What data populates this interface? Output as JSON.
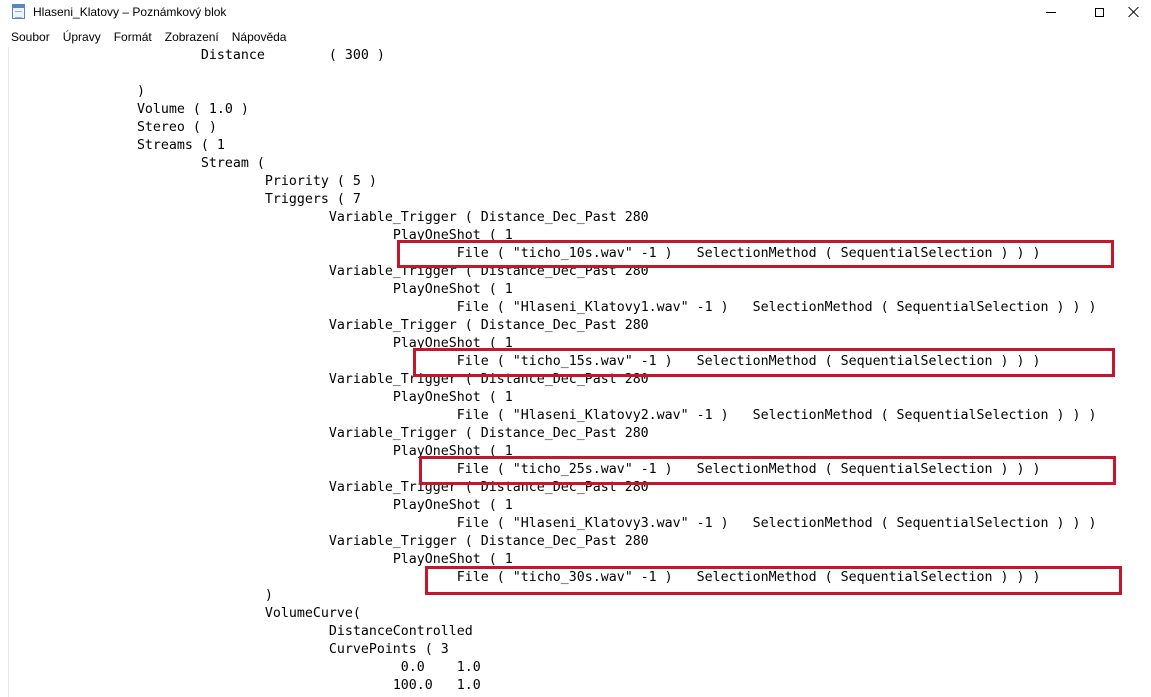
{
  "window": {
    "title": "Hlaseni_Klatovy – Poznámkový blok",
    "icon": "notepad-icon",
    "controls": [
      "minimize-icon",
      "maximize-icon",
      "close-icon"
    ]
  },
  "menu": [
    "Soubor",
    "Úpravy",
    "Formát",
    "Zobrazení",
    "Nápověda"
  ],
  "editor": {
    "lines": [
      "\t\t\tDistance\t( 300 )",
      "",
      "\t\t)",
      "\t\tVolume ( 1.0 )",
      "\t\tStereo ( )",
      "\t\tStreams ( 1",
      "\t\t\tStream (",
      "\t\t\t\tPriority ( 5 )",
      "\t\t\t\tTriggers ( 7",
      "\t\t\t\t\tVariable_Trigger ( Distance_Dec_Past 280",
      "\t\t\t\t\t\tPlayOneShot ( 1",
      "\t\t\t\t\t\t\tFile ( \"ticho_10s.wav\" -1 )   SelectionMethod ( SequentialSelection ) ) )",
      "\t\t\t\t\tVariable_Trigger ( Distance_Dec_Past 280",
      "\t\t\t\t\t\tPlayOneShot ( 1",
      "\t\t\t\t\t\t\tFile ( \"Hlaseni_Klatovy1.wav\" -1 )   SelectionMethod ( SequentialSelection ) ) )",
      "\t\t\t\t\tVariable_Trigger ( Distance_Dec_Past 280",
      "\t\t\t\t\t\tPlayOneShot ( 1",
      "\t\t\t\t\t\t\tFile ( \"ticho_15s.wav\" -1 )   SelectionMethod ( SequentialSelection ) ) )",
      "\t\t\t\t\tVariable_Trigger ( Distance_Dec_Past 280",
      "\t\t\t\t\t\tPlayOneShot ( 1",
      "\t\t\t\t\t\t\tFile ( \"Hlaseni_Klatovy2.wav\" -1 )   SelectionMethod ( SequentialSelection ) ) )",
      "\t\t\t\t\tVariable_Trigger ( Distance_Dec_Past 280",
      "\t\t\t\t\t\tPlayOneShot ( 1",
      "\t\t\t\t\t\t\tFile ( \"ticho_25s.wav\" -1 )   SelectionMethod ( SequentialSelection ) ) )",
      "\t\t\t\t\tVariable_Trigger ( Distance_Dec_Past 280",
      "\t\t\t\t\t\tPlayOneShot ( 1",
      "\t\t\t\t\t\t\tFile ( \"Hlaseni_Klatovy3.wav\" -1 )   SelectionMethod ( SequentialSelection ) ) )",
      "\t\t\t\t\tVariable_Trigger ( Distance_Dec_Past 280",
      "\t\t\t\t\t\tPlayOneShot ( 1",
      "\t\t\t\t\t\t\tFile ( \"ticho_30s.wav\" -1 )   SelectionMethod ( SequentialSelection ) ) )",
      "\t\t\t\t)",
      "\t\t\t\tVolumeCurve(",
      "\t\t\t\t\tDistanceControlled",
      "\t\t\t\t\tCurvePoints ( 3",
      "\t\t\t\t\t\t 0.0\t1.0",
      "\t\t\t\t\t\t100.0\t1.0"
    ],
    "highlight_color": "#c4172c"
  }
}
